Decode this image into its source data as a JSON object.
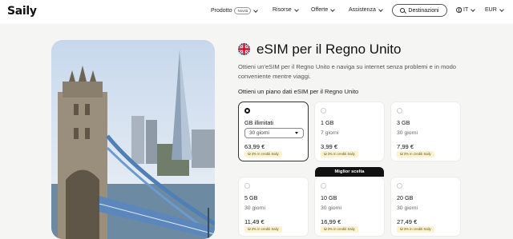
{
  "brand": {
    "logo_text": "Saily"
  },
  "nav": {
    "product": "Prodotto",
    "new_badge": "Novità",
    "resources": "Risorse",
    "offers": "Offerte",
    "support": "Assistenza",
    "destinations_button": "Destinazioni",
    "language": "IT",
    "currency": "EUR"
  },
  "hero": {
    "title": "eSIM per il Regno Unito",
    "description": "Ottieni un'eSIM per il Regno Unito e naviga su internet senza problemi e in modo conveniente mentre viaggi.",
    "plans_title": "Ottieni un piano dati eSIM per il Regno Unito"
  },
  "best_choice_label": "Miglior scelta",
  "plans": [
    {
      "name": "GB illimitati",
      "duration": "30 giorni",
      "price": "63,99 €",
      "credit": "3% in crediti Saily",
      "selected": true
    },
    {
      "name": "1 GB",
      "duration": "7 giorni",
      "price": "3,99 €",
      "credit": "3% in crediti Saily",
      "selected": false
    },
    {
      "name": "3 GB",
      "duration": "30 giorni",
      "price": "7,99 €",
      "credit": "3% in crediti Saily",
      "selected": false
    },
    {
      "name": "5 GB",
      "duration": "30 giorni",
      "price": "11,49 €",
      "credit": "3% in crediti Saily",
      "selected": false
    },
    {
      "name": "10 GB",
      "duration": "30 giorni",
      "price": "16,99 €",
      "credit": "3% in crediti Saily",
      "selected": false
    },
    {
      "name": "20 GB",
      "duration": "30 giorni",
      "price": "27,49 €",
      "credit": "3% in crediti Saily",
      "selected": false
    }
  ],
  "colors": {
    "credit_bg": "#fbf2d2",
    "band_bg": "#f5f5f4",
    "badge_bg": "#111111"
  }
}
